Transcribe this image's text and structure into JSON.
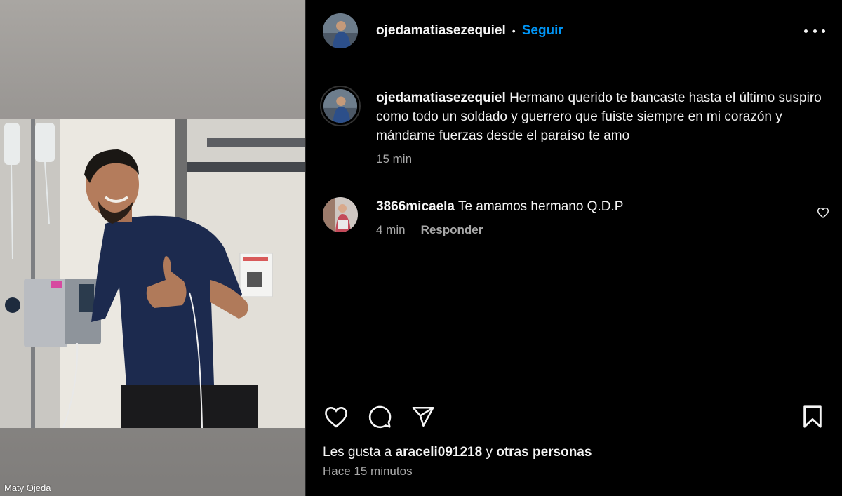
{
  "media": {
    "watermark": "Maty Ojeda"
  },
  "header": {
    "username": "ojedamatiasezequiel",
    "separator": "•",
    "follow_label": "Seguir",
    "more_icon": "more-horizontal-icon"
  },
  "caption": {
    "username": "ojedamatiasezequiel",
    "text": "Hermano querido te bancaste hasta el último suspiro como todo un soldado y guerrero que fuiste siempre en mi corazón y mándame fuerzas desde el paraíso te amo",
    "time": "15 min"
  },
  "comments": [
    {
      "username": "3866micaela",
      "text": "Te amamos hermano Q.D.P",
      "time": "4 min",
      "reply_label": "Responder"
    }
  ],
  "actions": {
    "like_icon": "heart-icon",
    "comment_icon": "comment-icon",
    "share_icon": "send-icon",
    "save_icon": "bookmark-icon"
  },
  "likes": {
    "prefix": "Les gusta a",
    "user": "araceli091218",
    "connector": "y",
    "others": "otras personas"
  },
  "posted": "Hace 15 minutos",
  "colors": {
    "background": "#000000",
    "link": "#0095f6",
    "secondary_text": "#a8a8a8",
    "divider": "#262626"
  }
}
